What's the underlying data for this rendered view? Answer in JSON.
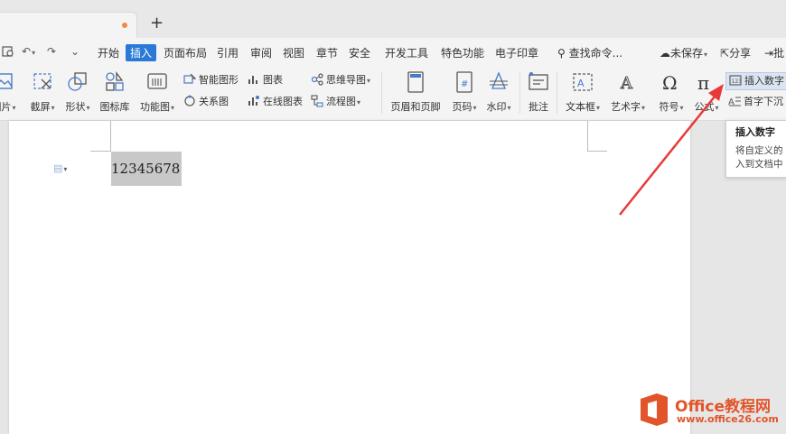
{
  "tabbar": {
    "new_tab": "+"
  },
  "menu": {
    "items": [
      "开始",
      "插入",
      "页面布局",
      "引用",
      "审阅",
      "视图",
      "章节",
      "安全",
      "开发工具",
      "特色功能",
      "电子印章"
    ],
    "active_index": 1,
    "search": "查找命令...",
    "save_status": "未保存",
    "share": "分享",
    "batch": "批"
  },
  "ribbon": {
    "picture": "图片",
    "screenshot": "截屏",
    "shapes": "形状",
    "icon_lib": "图标库",
    "function_chart": "功能图",
    "smart_art": "智能图形",
    "chart": "图表",
    "mind_map": "思维导图",
    "relation": "关系图",
    "online_chart": "在线图表",
    "flowchart": "流程图",
    "header_footer": "页眉和页脚",
    "page_number": "页码",
    "watermark": "水印",
    "comment": "批注",
    "textbox": "文本框",
    "art_text": "艺术字",
    "symbol": "符号",
    "formula": "公式",
    "insert_number": "插入数字",
    "drop_cap": "首字下沉"
  },
  "document": {
    "text": "12345678"
  },
  "tooltip": {
    "title": "插入数字",
    "desc_line1": "将自定义的",
    "desc_line2": "入到文档中"
  },
  "watermark": {
    "brand": "Office教程网",
    "url": "www.office26.com"
  },
  "colors": {
    "accent": "#2b79d6",
    "arrow": "#e83a3a",
    "brand": "#e2552a"
  }
}
